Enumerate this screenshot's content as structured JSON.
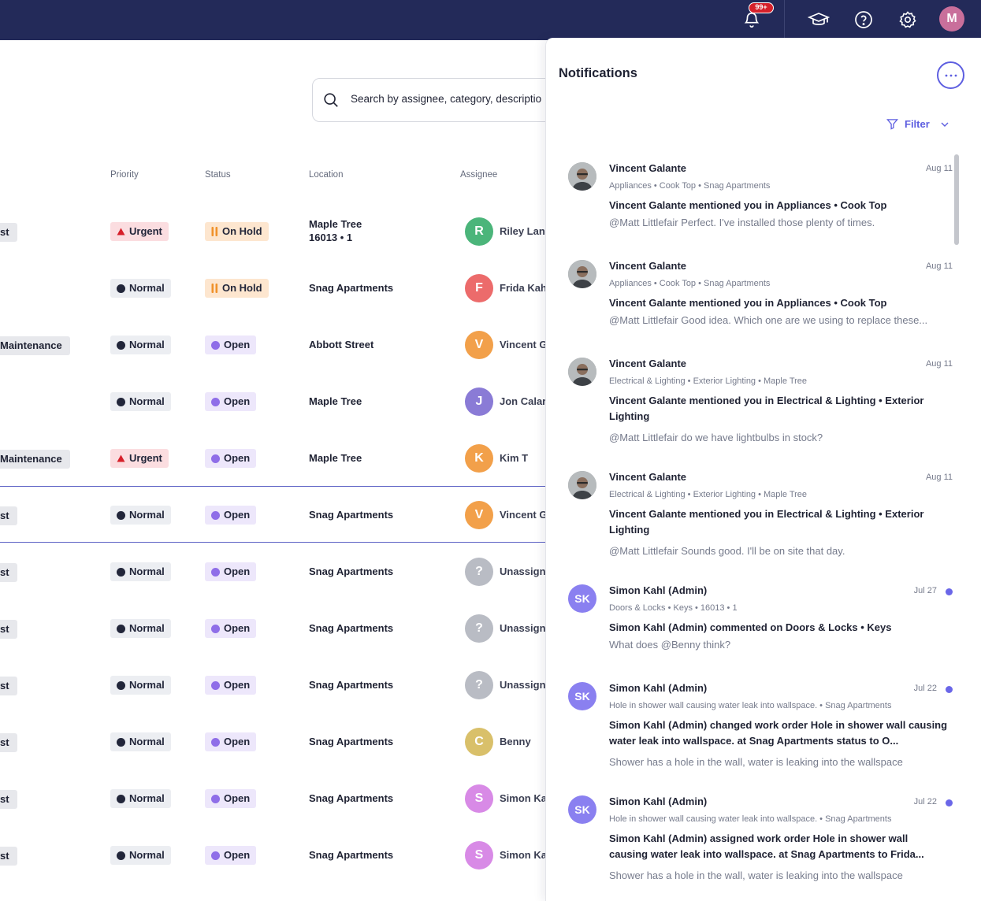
{
  "topbar": {
    "notification_count": "99+",
    "user_initial": "M",
    "icons": [
      "bell-icon",
      "graduation-cap-icon",
      "help-icon",
      "gear-icon"
    ]
  },
  "search": {
    "placeholder": "Search by assignee, category, descriptio"
  },
  "table": {
    "headers": {
      "priority": "Priority",
      "status": "Status",
      "location": "Location",
      "assignee": "Assignee"
    },
    "rows": [
      {
        "category": "st",
        "priority": "Urgent",
        "status": "On Hold",
        "location": "Maple Tree",
        "location_sub": "16013 • 1",
        "initial": "R",
        "avatar_color": "#4bb57a",
        "assignee": "Riley Lang"
      },
      {
        "category": "",
        "priority": "Normal",
        "status": "On Hold",
        "location": "Snag Apartments",
        "location_sub": "",
        "initial": "F",
        "avatar_color": "#ec6b6b",
        "assignee": "Frida Kah"
      },
      {
        "category": "Maintenance",
        "priority": "Normal",
        "status": "Open",
        "location": "Abbott Street",
        "location_sub": "",
        "initial": "V",
        "avatar_color": "#f2a04a",
        "assignee": "Vincent G"
      },
      {
        "category": "",
        "priority": "Normal",
        "status": "Open",
        "location": "Maple Tree",
        "location_sub": "",
        "initial": "J",
        "avatar_color": "#8a7bd6",
        "assignee": "Jon Calar"
      },
      {
        "category": "Maintenance",
        "priority": "Urgent",
        "status": "Open",
        "location": "Maple Tree",
        "location_sub": "",
        "initial": "K",
        "avatar_color": "#f2a04a",
        "assignee": "Kim T"
      },
      {
        "category": "st",
        "priority": "Normal",
        "status": "Open",
        "location": "Snag Apartments",
        "location_sub": "",
        "initial": "V",
        "avatar_color": "#f2a04a",
        "assignee": "Vincent G"
      },
      {
        "category": "st",
        "priority": "Normal",
        "status": "Open",
        "location": "Snag Apartments",
        "location_sub": "",
        "initial": "?",
        "avatar_color": "#b9bcc4",
        "assignee": "Unassign"
      },
      {
        "category": "st",
        "priority": "Normal",
        "status": "Open",
        "location": "Snag Apartments",
        "location_sub": "",
        "initial": "?",
        "avatar_color": "#b9bcc4",
        "assignee": "Unassign"
      },
      {
        "category": "st",
        "priority": "Normal",
        "status": "Open",
        "location": "Snag Apartments",
        "location_sub": "",
        "initial": "?",
        "avatar_color": "#b9bcc4",
        "assignee": "Unassign"
      },
      {
        "category": "st",
        "priority": "Normal",
        "status": "Open",
        "location": "Snag Apartments",
        "location_sub": "",
        "initial": "C",
        "avatar_color": "#d9c06a",
        "assignee": "Benny"
      },
      {
        "category": "st",
        "priority": "Normal",
        "status": "Open",
        "location": "Snag Apartments",
        "location_sub": "",
        "initial": "S",
        "avatar_color": "#d88ae6",
        "assignee": "Simon Ka"
      },
      {
        "category": "st",
        "priority": "Normal",
        "status": "Open",
        "location": "Snag Apartments",
        "location_sub": "",
        "initial": "S",
        "avatar_color": "#d88ae6",
        "assignee": "Simon Ka"
      }
    ]
  },
  "notifications": {
    "title": "Notifications",
    "filter_label": "Filter",
    "items": [
      {
        "name": "Vincent Galante",
        "avatar": "photo",
        "date": "Aug 11",
        "unread": false,
        "meta": "Appliances • Cook Top   •   Snag Apartments",
        "message": "Vincent Galante mentioned you in Appliances • Cook Top",
        "body": "@Matt Littlefair Perfect. I've installed those plenty of times."
      },
      {
        "name": "Vincent Galante",
        "avatar": "photo",
        "date": "Aug 11",
        "unread": false,
        "meta": "Appliances • Cook Top   •   Snag Apartments",
        "message": "Vincent Galante mentioned you in Appliances • Cook Top",
        "body": "@Matt Littlefair Good idea. Which one are we using to replace these..."
      },
      {
        "name": "Vincent Galante",
        "avatar": "photo",
        "date": "Aug 11",
        "unread": false,
        "meta": "Electrical & Lighting • Exterior Lighting   •   Maple Tree",
        "message": "Vincent Galante mentioned you in Electrical & Lighting • Exterior Lighting",
        "body": "@Matt Littlefair do we have lightbulbs in stock?"
      },
      {
        "name": "Vincent Galante",
        "avatar": "photo",
        "date": "Aug 11",
        "unread": false,
        "meta": "Electrical & Lighting • Exterior Lighting   •   Maple Tree",
        "message": "Vincent Galante mentioned you in Electrical & Lighting • Exterior Lighting",
        "body": "@Matt Littlefair Sounds good. I'll be on site that day."
      },
      {
        "name": "Simon Kahl (Admin)",
        "avatar": "SK",
        "date": "Jul 27",
        "unread": true,
        "meta": "Doors & Locks • Keys   •   16013 • 1",
        "message": "Simon Kahl (Admin) commented on Doors & Locks • Keys",
        "body": "What does @Benny think?"
      },
      {
        "name": "Simon Kahl (Admin)",
        "avatar": "SK",
        "date": "Jul 22",
        "unread": true,
        "meta": "Hole in shower wall causing water leak into wallspace.   •   Snag Apartments",
        "message": "Simon Kahl (Admin) changed work order Hole in shower wall causing water leak into wallspace. at Snag Apartments status to O...",
        "body": "Shower has a hole in the wall, water is leaking into the wallspace"
      },
      {
        "name": "Simon Kahl (Admin)",
        "avatar": "SK",
        "date": "Jul 22",
        "unread": true,
        "meta": "Hole in shower wall causing water leak into wallspace.   •   Snag Apartments",
        "message": "Simon Kahl (Admin) assigned work order Hole in shower wall causing water leak into wallspace. at Snag Apartments to Frida...",
        "body": "Shower has a hole in the wall, water is leaking into the wallspace"
      }
    ]
  }
}
